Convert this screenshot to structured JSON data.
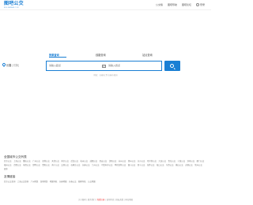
{
  "header": {
    "logo_text": "图吧公交",
    "logo_sub": "BUS.MAPBAR.COM",
    "nav": [
      "公交版",
      "图吧导航",
      "图吧论坛",
      "登录"
    ]
  },
  "tabs": [
    "换乘查询",
    "线路查询",
    "站点查询"
  ],
  "city": {
    "name": "长春",
    "switch": "[切换]"
  },
  "search": {
    "start_placeholder": "请输入起点",
    "end_placeholder": "请输入终点",
    "swap_icon": "⇄",
    "hint": "例如：长春站 到 长春市政府"
  },
  "sections": {
    "city_title": "全国城市公交列表",
    "route_title": "友情链接"
  },
  "cities": [
    "北京公交",
    "上海公交",
    "重庆公交",
    "广州公交",
    "深圳公交",
    "天津公交",
    "南京公交",
    "武汉公交",
    "杭州公交",
    "成都公交",
    "西安公交",
    "沈阳公交",
    "苏州公交",
    "郑州公交",
    "长沙公交",
    "哈尔滨公交",
    "大连公交",
    "青岛公交",
    "宁波公交",
    "济南公交",
    "厦门公交",
    "福州公交",
    "合肥公交",
    "南昌公交",
    "昆明公交",
    "贵阳公交",
    "南宁公交",
    "太原公交",
    "石家庄公交",
    "长春公交",
    "兰州公交",
    "乌鲁木齐公交",
    "呼和浩特公交",
    "银川公交",
    "西宁公交",
    "拉萨公交",
    "海口公交",
    "东莞公交",
    "佛山公交",
    "无锡公交",
    "常州公交",
    "更多"
  ],
  "links": [
    "北京公交查询",
    "上海公交查询",
    "广州地铁",
    "深圳地铁",
    "地图导航",
    "长春地图",
    "长春公交",
    "图吧导航",
    "公交地图"
  ],
  "footer": {
    "prefix": "关于图吧 | 联系我们 | ",
    "accent": "免费注册",
    "suffix": " | 使用条款 | 隐私政策 | 网站地图"
  }
}
